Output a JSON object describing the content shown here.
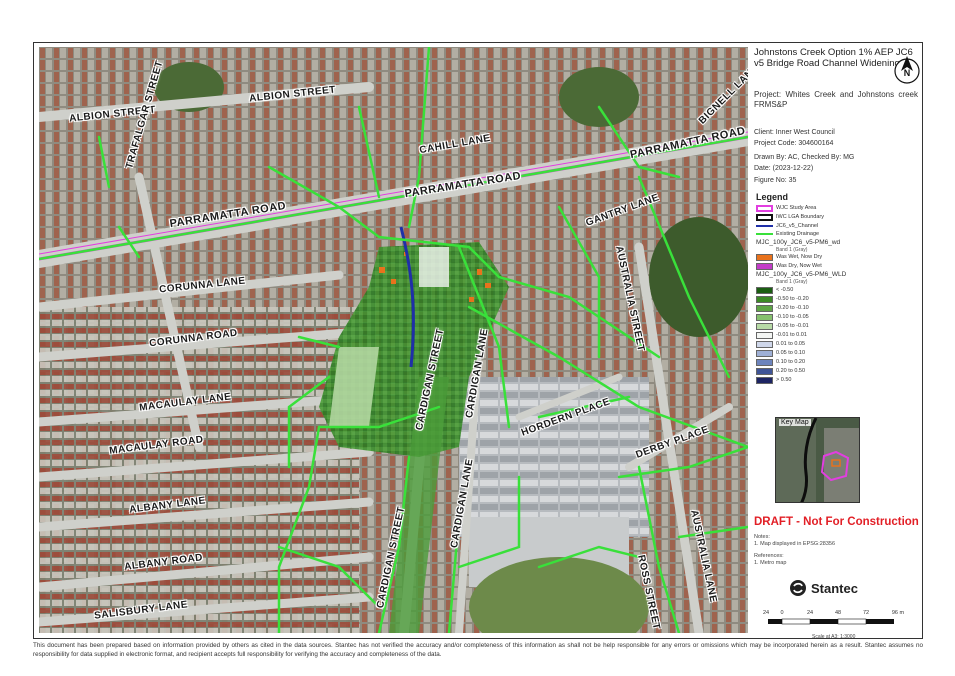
{
  "header": {
    "title": "Johnstons Creek Option 1% AEP JC6 v5 Bridge Road Channel Widening",
    "project": "Project: Whites Creek and Johnstons creek FRMS&P",
    "client": "Client: Inner West Council",
    "project_code": "Project Code: 304600164",
    "drawn_by": "Drawn By: AC, Checked By: MG",
    "date": "Date: (2023-12-22)",
    "figure": "Figure No: 35"
  },
  "north_arrow": {
    "label": "N",
    "icon": "north-arrow-icon"
  },
  "map": {
    "streets": [
      "ALBION STREET",
      "ALBION STREET",
      "TRAFALGAR STREET",
      "CAHILL LANE",
      "PARRAMATTA ROAD",
      "PARRAMATTA ROAD",
      "PARRAMATTA ROAD",
      "BIGNELL LANE",
      "GANTRY LANE",
      "CORUNNA LANE",
      "CORUNNA ROAD",
      "MACAULAY LANE",
      "MACAULAY ROAD",
      "ALBANY LANE",
      "ALBANY ROAD",
      "SALISBURY LANE",
      "CARDIGAN STREET",
      "CARDIGAN LANE",
      "CARDIGAN LANE",
      "CARDIGAN STREET",
      "AUSTRALIA STREET",
      "HORDERN PLACE",
      "DERBY PLACE",
      "AUSTRALIA LANE",
      "ROSS STREET"
    ]
  },
  "legend": {
    "title": "Legend",
    "lines": [
      {
        "label": "WJC Study Area",
        "color": "#e23ee0"
      },
      {
        "label": "IWC LGA Boundary",
        "color": "#111111"
      },
      {
        "label": "JC6_v5_Channel",
        "color": "#1f2fa8"
      },
      {
        "label": "Existing Drainage",
        "color": "#39e03a"
      }
    ],
    "wd_head": "MJC_100y_JC6_v5-PM6_wd",
    "wd_band": "Band 1 (Gray)",
    "wd_items": [
      {
        "label": "Was Wet, Now Dry",
        "color": "#e8721c"
      },
      {
        "label": "Was Dry, Now Wet",
        "color": "#c23cc8"
      }
    ],
    "wld_head": "MJC_100y_JC6_v5-PM6_WLD",
    "wld_band": "Band 1 (Gray)",
    "wld_items": [
      {
        "label": "< -0.50",
        "color": "#1b5e12"
      },
      {
        "label": "-0.50 to -0.20",
        "color": "#3c8a26"
      },
      {
        "label": "-0.20 to -0.10",
        "color": "#5ea545"
      },
      {
        "label": "-0.10 to -0.05",
        "color": "#86c06e"
      },
      {
        "label": "-0.05 to -0.01",
        "color": "#b8dba7"
      },
      {
        "label": "-0.01 to 0.01",
        "color": "#f4f6f4"
      },
      {
        "label": "0.01 to 0.05",
        "color": "#cfd7ea"
      },
      {
        "label": "0.05 to 0.10",
        "color": "#9fb0d6"
      },
      {
        "label": "0.10 to 0.20",
        "color": "#6d84bd"
      },
      {
        "label": "0.20 to 0.50",
        "color": "#3f5497"
      },
      {
        "label": "> 0.50",
        "color": "#1d2463"
      }
    ]
  },
  "keymap": {
    "label": "Key Map"
  },
  "draft": "DRAFT - Not For Construction",
  "notes_head": "Notes:",
  "notes": "1. Map displayed in EPSG:28356",
  "references_head": "References:",
  "references": "1. Metro map",
  "logo": {
    "name": "Stantec",
    "icon": "stantec-logo-icon"
  },
  "scale": {
    "ticks": [
      "24",
      "0",
      "24",
      "48",
      "72",
      "96 m"
    ],
    "label": "Scale at A3: 1:3000"
  },
  "disclaimer": "This document has been prepared based on information provided by others as cited in the data sources. Stantec has not verified the accuracy and/or completeness of this information as shall not be help responsible for any errors or omissions which may be incorporated herein as a result. Stantec assumes no responsibility for data supplied in electronic format, and recipient accepts full responsibility for verifying the accuracy and completeness of the data."
}
